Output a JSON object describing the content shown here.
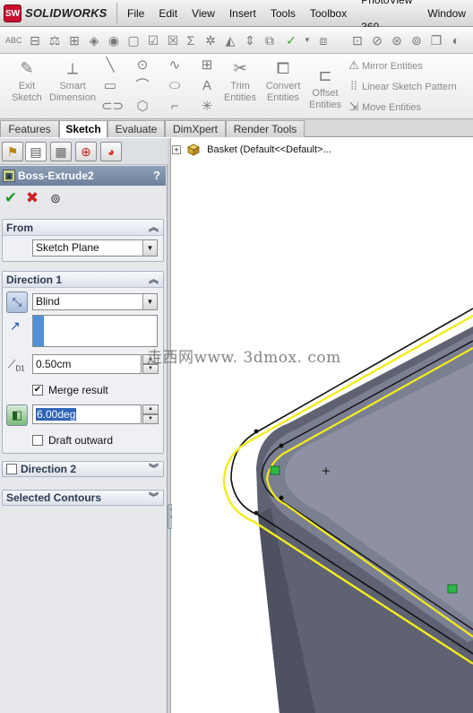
{
  "app": {
    "logo_text": "SOLIDWORKS",
    "logo_mark": "SW"
  },
  "menu": [
    "File",
    "Edit",
    "View",
    "Insert",
    "Tools",
    "Toolbox",
    "PhotoView 360",
    "Window"
  ],
  "command_manager": {
    "exit_sketch": "Exit Sketch",
    "smart_dimension": "Smart Dimension",
    "trim_entities": "Trim Entities",
    "convert_entities": "Convert Entities",
    "offset_entities": "Offset Entities",
    "mirror_entities": "Mirror Entities",
    "linear_pattern": "Linear Sketch Pattern",
    "move_entities": "Move Entities"
  },
  "tabs": [
    "Features",
    "Sketch",
    "Evaluate",
    "DimXpert",
    "Render Tools"
  ],
  "active_tab": "Sketch",
  "feature": {
    "title": "Boss-Extrude2",
    "help": "?"
  },
  "from_group": {
    "title": "From",
    "start_condition": "Sketch Plane"
  },
  "direction1": {
    "title": "Direction 1",
    "end_condition": "Blind",
    "depth_label": "D1",
    "depth": "0.50cm",
    "merge_result_label": "Merge result",
    "merge_result": true,
    "draft_angle": "6.00deg",
    "draft_outward_label": "Draft outward",
    "draft_outward": false
  },
  "direction2": {
    "title": "Direction 2"
  },
  "selected_contours": {
    "title": "Selected Contours"
  },
  "tree": {
    "root_label": "Basket  (Default<<Default>..."
  },
  "watermark": "走西网www. 3dmox. com",
  "colors": {
    "accent_header": "#7a8ca7",
    "sketch_yellow": "#f2ec1c",
    "model_face": "#5f6272",
    "ok_green": "#1e9a2e",
    "cancel_red": "#cc1f1f"
  }
}
